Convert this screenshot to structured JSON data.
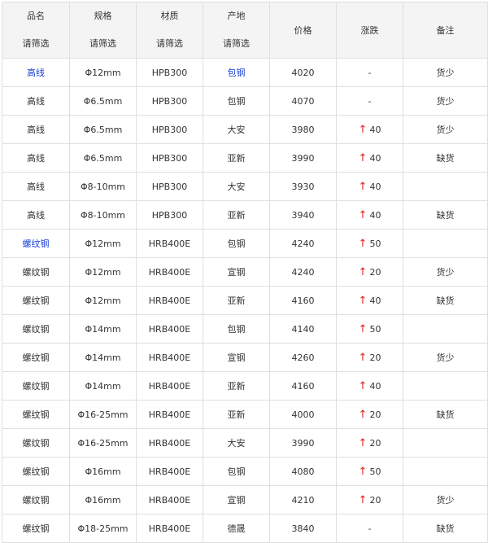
{
  "headers": [
    {
      "label": "品名",
      "filter": "请筛选"
    },
    {
      "label": "规格",
      "filter": "请筛选"
    },
    {
      "label": "材质",
      "filter": "请筛选"
    },
    {
      "label": "产地",
      "filter": "请筛选"
    },
    {
      "label": "价格"
    },
    {
      "label": "涨跌"
    },
    {
      "label": "备注"
    }
  ],
  "colors": {
    "link": "#1a3fd6",
    "up_arrow": "#e02020",
    "border": "#dfdfdf",
    "header_bg": "#f4f4f4"
  },
  "rows": [
    {
      "name": "高线",
      "name_link": true,
      "spec": "Φ12mm",
      "material": "HPB300",
      "origin": "包钢",
      "origin_link": true,
      "price": "4020",
      "up": false,
      "change": "-",
      "note": "货少"
    },
    {
      "name": "高线",
      "spec": "Φ6.5mm",
      "material": "HPB300",
      "origin": "包钢",
      "price": "4070",
      "up": false,
      "change": "-",
      "note": "货少"
    },
    {
      "name": "高线",
      "spec": "Φ6.5mm",
      "material": "HPB300",
      "origin": "大安",
      "price": "3980",
      "up": true,
      "change": "40",
      "note": "货少"
    },
    {
      "name": "高线",
      "spec": "Φ6.5mm",
      "material": "HPB300",
      "origin": "亚新",
      "price": "3990",
      "up": true,
      "change": "40",
      "note": "缺货"
    },
    {
      "name": "高线",
      "spec": "Φ8-10mm",
      "material": "HPB300",
      "origin": "大安",
      "price": "3930",
      "up": true,
      "change": "40",
      "note": ""
    },
    {
      "name": "高线",
      "spec": "Φ8-10mm",
      "material": "HPB300",
      "origin": "亚新",
      "price": "3940",
      "up": true,
      "change": "40",
      "note": "缺货"
    },
    {
      "name": "螺纹钢",
      "name_link": true,
      "spec": "Φ12mm",
      "material": "HRB400E",
      "origin": "包钢",
      "price": "4240",
      "up": true,
      "change": "50",
      "note": ""
    },
    {
      "name": "螺纹钢",
      "spec": "Φ12mm",
      "material": "HRB400E",
      "origin": "宣钢",
      "price": "4240",
      "up": true,
      "change": "20",
      "note": "货少"
    },
    {
      "name": "螺纹钢",
      "spec": "Φ12mm",
      "material": "HRB400E",
      "origin": "亚新",
      "price": "4160",
      "up": true,
      "change": "40",
      "note": "缺货"
    },
    {
      "name": "螺纹钢",
      "spec": "Φ14mm",
      "material": "HRB400E",
      "origin": "包钢",
      "price": "4140",
      "up": true,
      "change": "50",
      "note": ""
    },
    {
      "name": "螺纹钢",
      "spec": "Φ14mm",
      "material": "HRB400E",
      "origin": "宣钢",
      "price": "4260",
      "up": true,
      "change": "20",
      "note": "货少"
    },
    {
      "name": "螺纹钢",
      "spec": "Φ14mm",
      "material": "HRB400E",
      "origin": "亚新",
      "price": "4160",
      "up": true,
      "change": "40",
      "note": ""
    },
    {
      "name": "螺纹钢",
      "spec": "Φ16-25mm",
      "material": "HRB400E",
      "origin": "亚新",
      "price": "4000",
      "up": true,
      "change": "20",
      "note": "缺货"
    },
    {
      "name": "螺纹钢",
      "spec": "Φ16-25mm",
      "material": "HRB400E",
      "origin": "大安",
      "price": "3990",
      "up": true,
      "change": "20",
      "note": ""
    },
    {
      "name": "螺纹钢",
      "spec": "Φ16mm",
      "material": "HRB400E",
      "origin": "包钢",
      "price": "4080",
      "up": true,
      "change": "50",
      "note": ""
    },
    {
      "name": "螺纹钢",
      "spec": "Φ16mm",
      "material": "HRB400E",
      "origin": "宣钢",
      "price": "4210",
      "up": true,
      "change": "20",
      "note": "货少"
    },
    {
      "name": "螺纹钢",
      "spec": "Φ18-25mm",
      "material": "HRB400E",
      "origin": "德晟",
      "price": "3840",
      "up": false,
      "change": "-",
      "note": "缺货"
    }
  ]
}
